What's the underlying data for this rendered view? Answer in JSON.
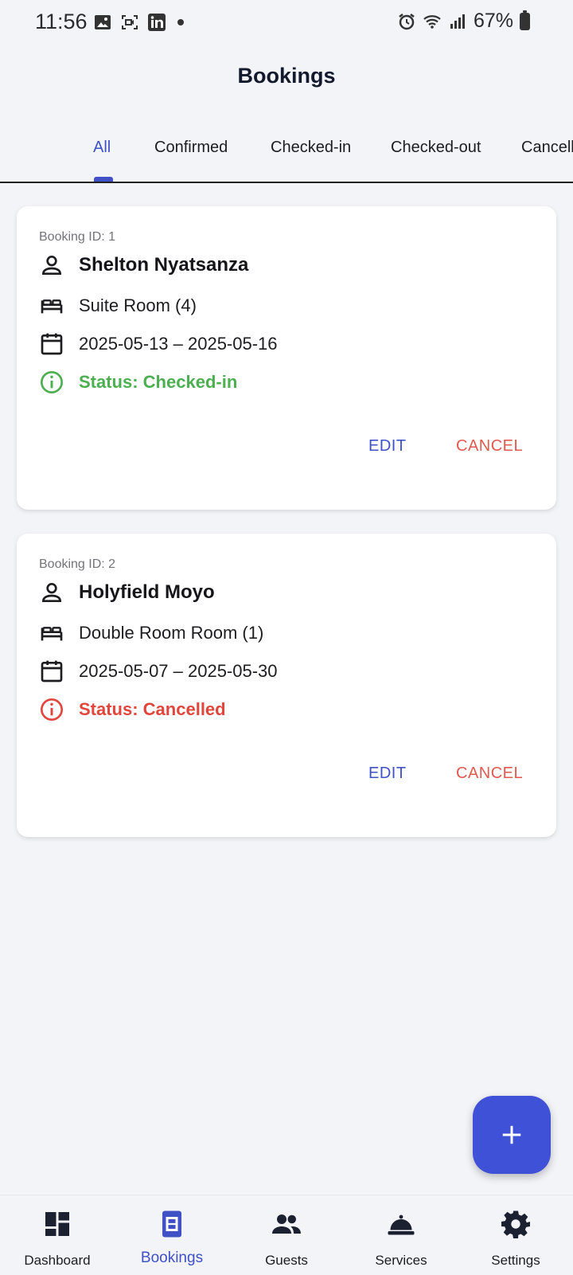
{
  "status_bar": {
    "time": "11:56",
    "battery": "67%",
    "icons": [
      "image-icon",
      "screen-record-icon",
      "linkedin-icon",
      "dot-icon",
      "alarm-icon",
      "wifi-icon",
      "signal-icon",
      "battery-icon"
    ]
  },
  "app_bar": {
    "title": "Bookings"
  },
  "tabs": [
    {
      "label": "All",
      "active": true
    },
    {
      "label": "Confirmed"
    },
    {
      "label": "Checked-in"
    },
    {
      "label": "Checked-out"
    },
    {
      "label": "Cancelled"
    }
  ],
  "bookings": [
    {
      "id_label": "Booking ID: 1",
      "guest": "Shelton Nyatsanza",
      "room": "Suite Room (4)",
      "dates": "2025-05-13 – 2025-05-16",
      "status": "Status: Checked-in",
      "status_color": "#4caf50",
      "edit_label": "EDIT",
      "cancel_label": "CANCEL"
    },
    {
      "id_label": "Booking ID: 2",
      "guest": "Holyfield Moyo",
      "room": "Double Room Room (1)",
      "dates": "2025-05-07 – 2025-05-30",
      "status": "Status: Cancelled",
      "status_color": "#e0463c",
      "edit_label": "EDIT",
      "cancel_label": "CANCEL"
    }
  ],
  "fab": {
    "icon": "plus-icon"
  },
  "bottom_nav": [
    {
      "label": "Dashboard",
      "icon": "dashboard-icon"
    },
    {
      "label": "Bookings",
      "icon": "bookings-icon",
      "active": true
    },
    {
      "label": "Guests",
      "icon": "guests-icon"
    },
    {
      "label": "Services",
      "icon": "services-icon"
    },
    {
      "label": "Settings",
      "icon": "settings-icon"
    }
  ],
  "colors": {
    "accent": "#3f51c4",
    "fab": "#3f51d6",
    "cancel": "#e05a4f",
    "background": "#f3f4f8"
  }
}
